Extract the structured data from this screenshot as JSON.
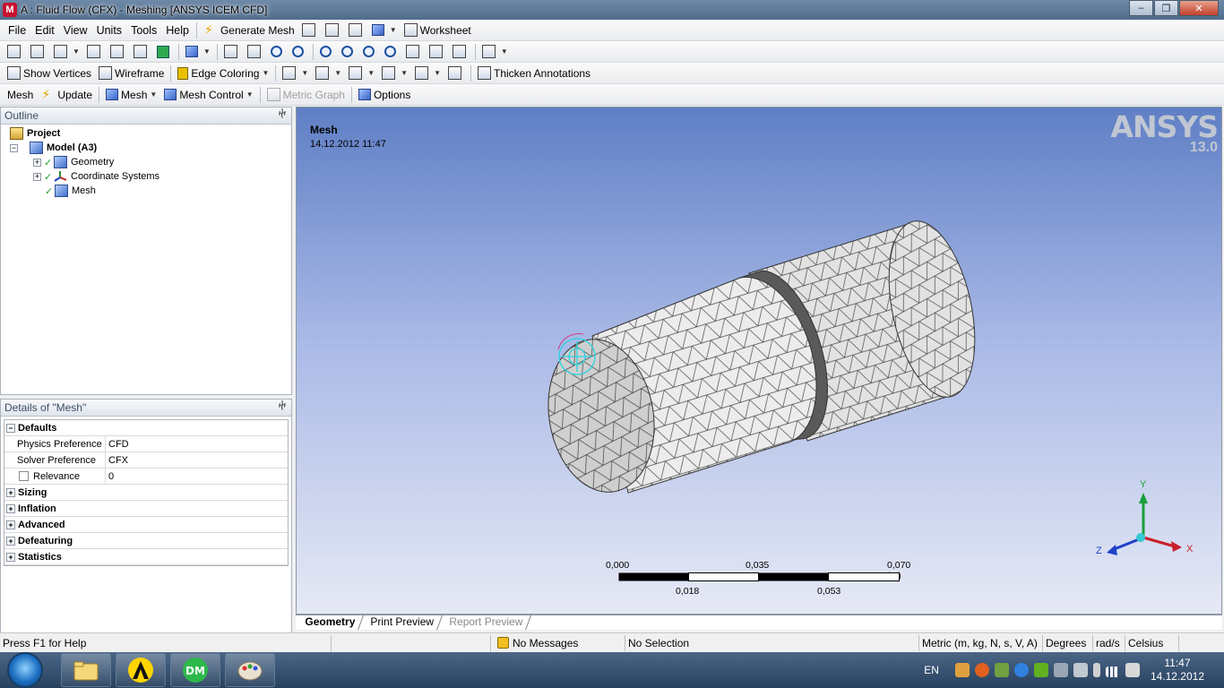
{
  "window": {
    "title": "A : Fluid Flow (CFX) - Meshing [ANSYS ICEM CFD]",
    "app_icon": "M",
    "controls": {
      "minimize": "–",
      "restore": "❐",
      "close": "✕"
    }
  },
  "menu": [
    "File",
    "Edit",
    "View",
    "Units",
    "Tools",
    "Help"
  ],
  "toolbar1": {
    "generate_mesh": "Generate Mesh",
    "worksheet": "Worksheet"
  },
  "toolbar2": {
    "show_vertices": "Show Vertices",
    "wireframe": "Wireframe",
    "edge_coloring": "Edge Coloring",
    "thicken_annotations": "Thicken Annotations"
  },
  "toolbar3": {
    "mesh": "Mesh",
    "update": "Update",
    "mesh_dropdown": "Mesh",
    "mesh_control": "Mesh Control",
    "metric_graph": "Metric Graph",
    "options": "Options"
  },
  "outline": {
    "title": "Outline",
    "pin": "ⴕ",
    "project": "Project",
    "model": "Model (A3)",
    "items": [
      "Geometry",
      "Coordinate Systems",
      "Mesh"
    ]
  },
  "details": {
    "title": "Details of \"Mesh\"",
    "pin": "ⴕ",
    "defaults": "Defaults",
    "rows": [
      {
        "key": "Physics Preference",
        "val": "CFD"
      },
      {
        "key": "Solver Preference",
        "val": "CFX"
      },
      {
        "key": "Relevance",
        "val": "0"
      }
    ],
    "categories": [
      "Sizing",
      "Inflation",
      "Advanced",
      "Defeaturing",
      "Statistics"
    ]
  },
  "viewport": {
    "title": "Mesh",
    "date": "14.12.2012 11:47",
    "brand": "ANSYS",
    "version": "13.0",
    "scale_top": [
      "0,000",
      "0,035",
      "0,070 (m)"
    ],
    "scale_bottom": [
      "0,018",
      "0,053"
    ],
    "axes": {
      "x": "X",
      "y": "Y",
      "z": "Z"
    }
  },
  "tabs": [
    "Geometry",
    "Print Preview",
    "Report Preview"
  ],
  "status": {
    "help": "Press F1 for Help",
    "messages": "No Messages",
    "selection": "No Selection",
    "units": "Metric (m, kg, N, s, V, A)",
    "angle": "Degrees",
    "rate": "rad/s",
    "temp": "Celsius"
  },
  "taskbar": {
    "lang": "EN",
    "time": "11:47",
    "date": "14.12.2012"
  }
}
